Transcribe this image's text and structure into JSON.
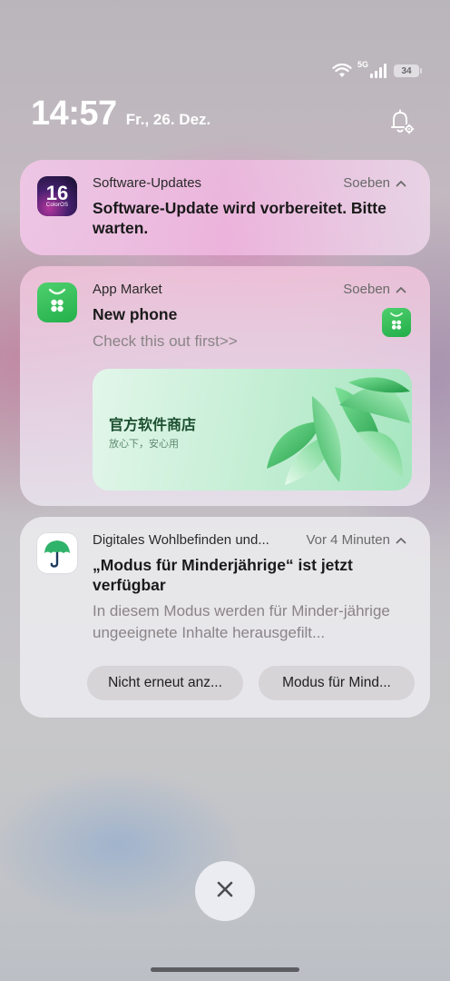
{
  "status_bar": {
    "network_label": "5G",
    "battery_level": "34",
    "icons": [
      "wifi-icon",
      "signal-icon",
      "battery-icon"
    ]
  },
  "lockscreen": {
    "time": "14:57",
    "date": "Fr., 26. Dez."
  },
  "notifications": [
    {
      "app_name": "Software-Updates",
      "time": "Soeben",
      "icon": "coloros-icon",
      "icon_text": "16",
      "icon_subtext": "ColorOS",
      "title": "Software-Update wird vorbereitet. Bitte warten."
    },
    {
      "app_name": "App Market",
      "time": "Soeben",
      "icon": "app-market-icon",
      "title": "New phone",
      "text": "Check this out first>>",
      "banner": {
        "title": "官方软件商店",
        "subtitle": "放心下，安心用"
      }
    },
    {
      "app_name": "Digitales Wohlbefinden und...",
      "time": "Vor 4 Minuten",
      "icon": "umbrella-icon",
      "title": "„Modus für Minderjährige“ ist jetzt verfügbar",
      "text": "In diesem Modus werden für Minder-jährige ungeeignete Inhalte herausgefilt...",
      "actions": [
        "Nicht erneut anz...",
        "Modus für Mind..."
      ]
    }
  ],
  "colors": {
    "market_green": "#2fbd55",
    "card_pink": "#f0bbe0",
    "card_neutral": "#ecebee"
  }
}
